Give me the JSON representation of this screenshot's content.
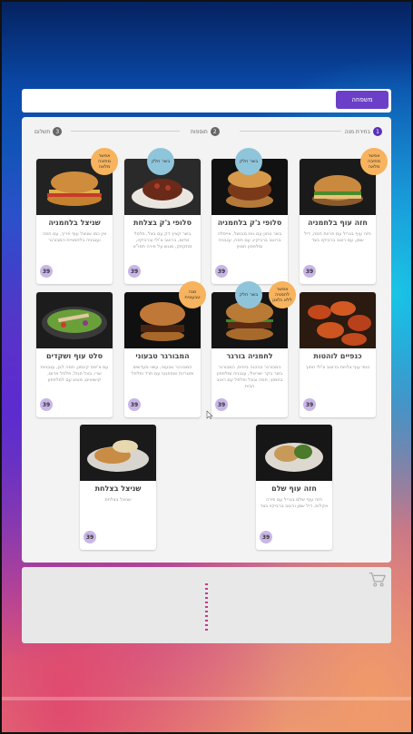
{
  "search": {
    "button_label": "משפחה"
  },
  "steps": [
    {
      "num": "1",
      "label": "בחירת מנה"
    },
    {
      "num": "2",
      "label": "תוספות"
    },
    {
      "num": "3",
      "label": "תשלום"
    }
  ],
  "dishes": [
    {
      "title": "חזה עוף בלחמניה",
      "desc": "חזה עוף בגריל עם פרוות חסה, דיל שמן, עם רוטב ברביקיו בצד",
      "price": "39",
      "badge": "אפשר מתיבה מלאה"
    },
    {
      "title": "סלופי ג'ק בלחמניה",
      "desc": "בשר טחון עם גאז מבושל, אייסלה ברוטב ברביקיו, עם חסה, עגבניה ומלפפון חמוץ",
      "price": "39",
      "badge": "בשר חלק"
    },
    {
      "title": "סלופי ג'ק בצלחת",
      "desc": "בשר קציץ דק עם בצל, פלפל אדום, ברוטב צ'ילי וברביקיו, מתקתק, מוגש על פירה תפו\"א",
      "price": "39",
      "badge": "בשר חלק"
    },
    {
      "title": "שניצל בלחמניה",
      "desc": "אין כמו שניצל עוף פריך, עם חסה ועגבניה בלחמניית המבורגר",
      "price": "39",
      "badge": "אפשר מתיבה מלאה"
    },
    {
      "title": "כנפיים לוהטות",
      "desc": "כנפי עוף צלויות ברוטב צ'ילי חתוך",
      "price": "39",
      "badge": ""
    },
    {
      "title": "לחמניה בורגר",
      "desc": "המבורגר בהכנה ביתית, המבורגר בשר בקר ישראלי, עגבניה ומלפפון בחמוץ, חסה ובצל ופלפל עם רוטב הבית",
      "price": "39",
      "badge": "בשר חלק",
      "badge2": "אפשר לחמניה ללא גלוטן"
    },
    {
      "title": "המבורגר טבעוני",
      "desc": "המבורגר טבעוני, עשוי מעדשים ופטריות ואספגטי עם תרד ופלפל",
      "price": "39",
      "badge": "מנה טבעונית"
    },
    {
      "title": "סלט עוף ושקדים",
      "desc": "עם צ'יפס קינמון, חסה לבן, עגבניות שרי, בצל סגול, פלפל אדום, קישואים, מוגש עם למלפפון",
      "price": "39",
      "badge": ""
    },
    {
      "title": "חזה עוף שלם",
      "desc": "חזה עוף שלם בגריל עם פירה אקלופ, דיל שמן ורוטב ברביקיו בצד",
      "price": "39",
      "badge": ""
    },
    {
      "title": "שניצל בצלחת",
      "desc": "שניצל בצלחת",
      "price": "39",
      "badge": ""
    }
  ],
  "icons": {
    "cart": "cart-icon",
    "step": "step-circle"
  }
}
